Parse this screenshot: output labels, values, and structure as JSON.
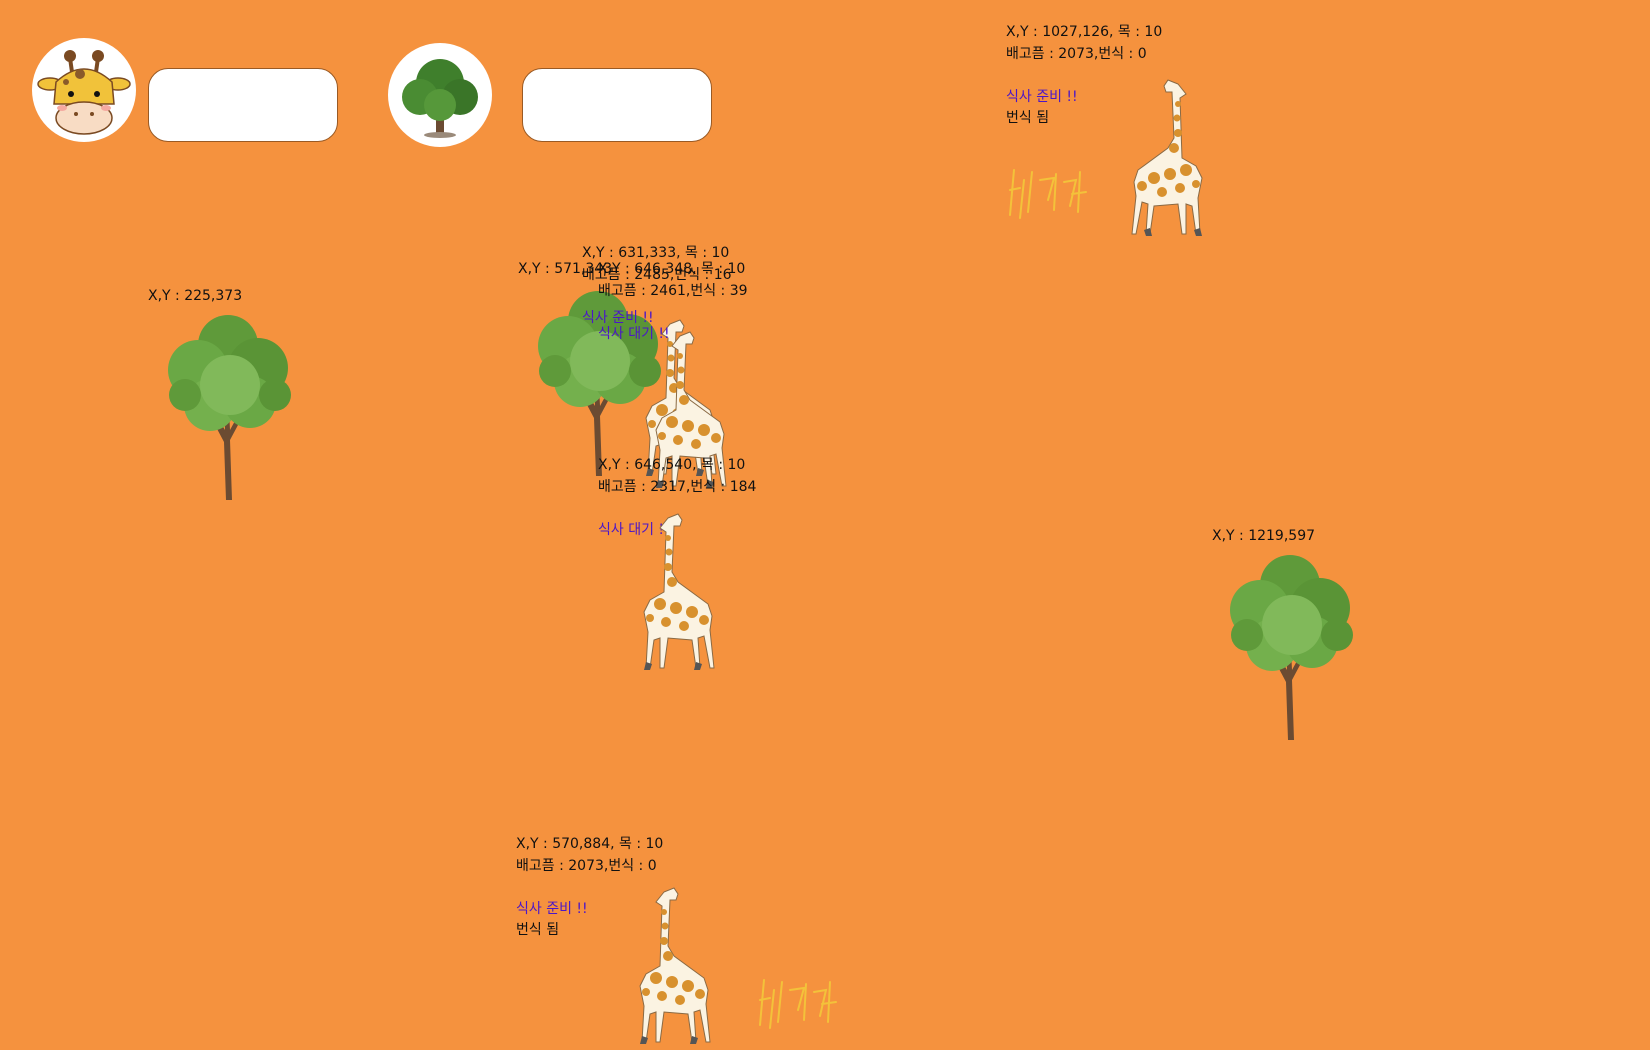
{
  "top_bar": {
    "giraffe_input": {
      "value": "",
      "placeholder": ""
    },
    "tree_input": {
      "value": "",
      "placeholder": ""
    },
    "giraffe_avatar_icon": "giraffe-face-icon",
    "tree_avatar_icon": "tree-icon"
  },
  "trees": [
    {
      "label": "X,Y : 225,373"
    },
    {
      "label": "X,Y : 571,343"
    },
    {
      "label": "X,Y : 1219,597"
    }
  ],
  "giraffes": [
    {
      "coords": "X,Y : 1027,126, 목 : 10",
      "hunger": "배고픔 : 2073,번식 : 0",
      "meal": "식사 준비 !!",
      "breed": "번식 됨",
      "baby_label": "새끼"
    },
    {
      "coords": "X,Y : 631,333, 목 : 10",
      "hunger": "배고픔 : 2485,번식 : 16",
      "meal": "식사 준비 !!"
    },
    {
      "coords": "X,Y : 646,348, 목 : 10",
      "hunger": "배고픔 : 2461,번식 : 39",
      "meal": "식사 대기 !!"
    },
    {
      "coords": "X,Y : 646,540, 목 : 10",
      "hunger": "배고픔 : 2317,번식 : 184",
      "meal": "식사 대기 !!"
    },
    {
      "coords": "X,Y : 570,884, 목 : 10",
      "hunger": "배고픔 : 2073,번식 : 0",
      "meal": "식사 준비 !!",
      "breed": "번식 됨",
      "baby_label": "새끼"
    }
  ]
}
